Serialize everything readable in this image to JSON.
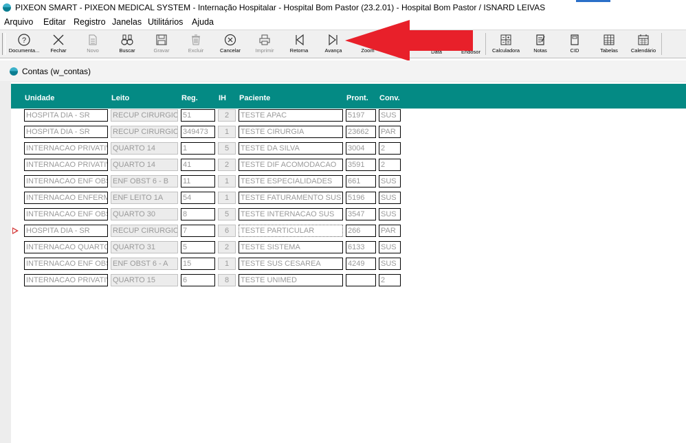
{
  "window": {
    "title": "PIXEON SMART - PIXEON MEDICAL SYSTEM - Internação Hospitalar - Hospital Bom Pastor (23.2.01) - Hospital Bom Pastor / ISNARD LEIVAS"
  },
  "menu": [
    "Arquivo",
    "Editar",
    "Registro",
    "Janelas",
    "Utilitários",
    "Ajuda"
  ],
  "toolbar": {
    "buttons": [
      {
        "label": "Documenta...",
        "icon": "help-circle-icon",
        "enabled": true
      },
      {
        "label": "Fechar",
        "icon": "close-x-icon",
        "enabled": true
      },
      {
        "label": "Novo",
        "icon": "new-document-icon",
        "enabled": false
      },
      {
        "label": "Buscar",
        "icon": "binoculars-icon",
        "enabled": true
      },
      {
        "label": "Gravar",
        "icon": "save-disk-icon",
        "enabled": false
      },
      {
        "label": "Excluir",
        "icon": "trash-icon",
        "enabled": false
      },
      {
        "label": "Cancelar",
        "icon": "cancel-circle-icon",
        "enabled": true
      },
      {
        "label": "Imprimir",
        "icon": "printer-icon",
        "enabled": false
      },
      {
        "label": "Retorna",
        "icon": "previous-icon",
        "enabled": true
      },
      {
        "label": "Avança",
        "icon": "next-icon",
        "enabled": true
      },
      {
        "label": "Zoom",
        "icon": "zoom-icon",
        "enabled": true
      },
      {
        "label": "",
        "icon": "hidden-icon",
        "enabled": true
      },
      {
        "label": "Data",
        "icon": "date-icon",
        "enabled": true
      },
      {
        "label": "Endosor",
        "icon": "tool-icon",
        "enabled": true
      },
      {
        "label": "Calculadora",
        "icon": "calculator-icon",
        "enabled": true
      },
      {
        "label": "Notas",
        "icon": "notes-icon",
        "enabled": true
      },
      {
        "label": "CID",
        "icon": "cid-book-icon",
        "enabled": true
      },
      {
        "label": "Tabelas",
        "icon": "tables-icon",
        "enabled": true
      },
      {
        "label": "Calendário",
        "icon": "calendar-icon",
        "enabled": true
      }
    ]
  },
  "annotation": {
    "arrow_color": "#e8202a"
  },
  "child_window": {
    "title": "Contas (w_contas)"
  },
  "colors": {
    "header_band": "#048a84",
    "row_pointer": "#d43a3a"
  },
  "table": {
    "headers": {
      "unidade": "Unidade",
      "leito": "Leito",
      "reg": "Reg.",
      "ih": "IH",
      "paciente": "Paciente",
      "pront": "Pront.",
      "conv": "Conv."
    },
    "rows": [
      {
        "unidade": "HOSPITA DIA - SR",
        "leito": "RECUP CIRURGICA",
        "reg": "51",
        "ih": "2",
        "paciente": "TESTE APAC",
        "pront": "5197",
        "conv": "SUS"
      },
      {
        "unidade": "HOSPITA DIA - SR",
        "leito": "RECUP CIRURGICA",
        "reg": "349473",
        "ih": "1",
        "paciente": "TESTE CIRURGIA",
        "pront": "23662",
        "conv": "PAR"
      },
      {
        "unidade": "INTERNACAO PRIVATIVO",
        "leito": "QUARTO 14",
        "reg": "1",
        "ih": "5",
        "paciente": "TESTE DA SILVA",
        "pront": "3004",
        "conv": "2"
      },
      {
        "unidade": "INTERNACAO PRIVATIVO",
        "leito": "QUARTO 14",
        "reg": "41",
        "ih": "2",
        "paciente": "TESTE DIF ACOMODACAO",
        "pront": "3591",
        "conv": "2"
      },
      {
        "unidade": "INTERNACAO ENF OBST",
        "leito": "ENF OBST 6 - B",
        "reg": "11",
        "ih": "1",
        "paciente": "TESTE ESPECIALIDADES",
        "pront": "661",
        "conv": "SUS"
      },
      {
        "unidade": "INTERNACAO ENFERMA",
        "leito": "ENF LEITO 1A",
        "reg": "54",
        "ih": "1",
        "paciente": "TESTE FATURAMENTO SUS",
        "pront": "5196",
        "conv": "SUS"
      },
      {
        "unidade": "INTERNACAO ENF OBST",
        "leito": "QUARTO 30",
        "reg": "8",
        "ih": "5",
        "paciente": "TESTE INTERNACAO SUS",
        "pront": "3547",
        "conv": "SUS"
      },
      {
        "unidade": "HOSPITA DIA - SR",
        "leito": "RECUP CIRURGICA",
        "reg": "7",
        "ih": "6",
        "paciente": "TESTE PARTICULAR",
        "pront": "266",
        "conv": "PAR"
      },
      {
        "unidade": "INTERNACAO QUARTO C",
        "leito": "QUARTO 31",
        "reg": "5",
        "ih": "2",
        "paciente": "TESTE SISTEMA",
        "pront": "6133",
        "conv": "SUS"
      },
      {
        "unidade": "INTERNACAO ENF OBST",
        "leito": "ENF OBST 6 - A",
        "reg": "15",
        "ih": "1",
        "paciente": "TESTE SUS CESAREA",
        "pront": "4249",
        "conv": "SUS"
      },
      {
        "unidade": "INTERNACAO PRIVATIVO",
        "leito": "QUARTO 15",
        "reg": "6",
        "ih": "8",
        "paciente": "TESTE UNIMED",
        "pront": "",
        "conv": "2"
      }
    ],
    "current_row": 7
  }
}
